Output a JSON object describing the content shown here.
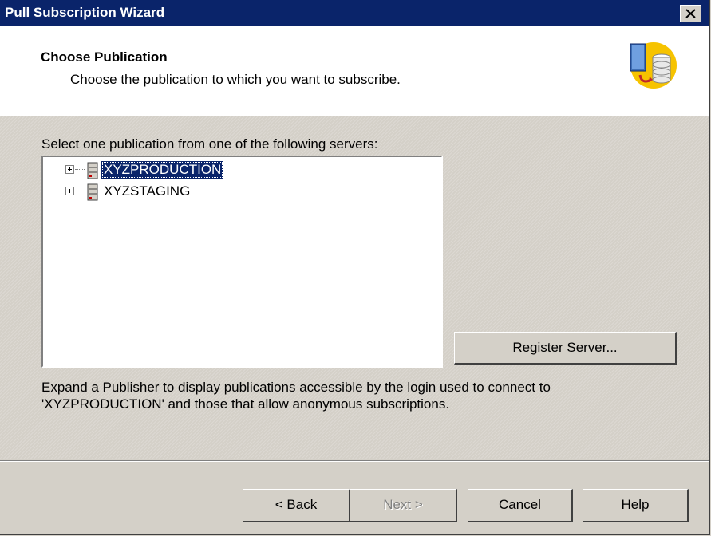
{
  "window": {
    "title": "Pull Subscription Wizard",
    "close_label": "×"
  },
  "header": {
    "title": "Choose Publication",
    "subtitle": "Choose the publication to which you want to subscribe.",
    "logo_icon": "wizard-database-icon"
  },
  "main": {
    "select_label": "Select one publication from one of the following servers:",
    "tree_items": [
      {
        "label": "XYZPRODUCTION",
        "selected": true,
        "icon": "server-icon",
        "expander": "plus"
      },
      {
        "label": "XYZSTAGING",
        "selected": false,
        "icon": "server-icon",
        "expander": "plus"
      }
    ],
    "register_button": "Register Server...",
    "help_text_line1": "Expand a Publisher to display publications accessible by the login used to connect to",
    "help_text_line2": "'XYZPRODUCTION' and those that allow anonymous subscriptions."
  },
  "footer": {
    "back": "< Back",
    "next": "Next >",
    "cancel": "Cancel",
    "help": "Help"
  },
  "colors": {
    "titlebar": "#0a246a",
    "selection": "#0a246a",
    "dialog_bg": "#d4d0c8"
  }
}
